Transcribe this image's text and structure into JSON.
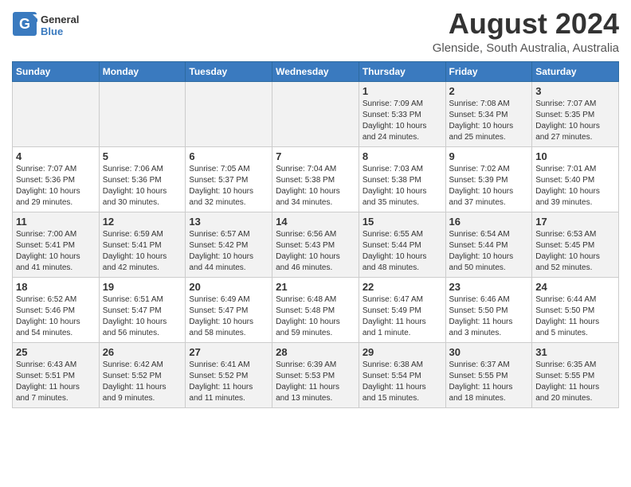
{
  "header": {
    "logo_general": "General",
    "logo_blue": "Blue",
    "main_title": "August 2024",
    "sub_title": "Glenside, South Australia, Australia"
  },
  "days_of_week": [
    "Sunday",
    "Monday",
    "Tuesday",
    "Wednesday",
    "Thursday",
    "Friday",
    "Saturday"
  ],
  "weeks": [
    [
      {
        "day": "",
        "info": ""
      },
      {
        "day": "",
        "info": ""
      },
      {
        "day": "",
        "info": ""
      },
      {
        "day": "",
        "info": ""
      },
      {
        "day": "1",
        "info": "Sunrise: 7:09 AM\nSunset: 5:33 PM\nDaylight: 10 hours\nand 24 minutes."
      },
      {
        "day": "2",
        "info": "Sunrise: 7:08 AM\nSunset: 5:34 PM\nDaylight: 10 hours\nand 25 minutes."
      },
      {
        "day": "3",
        "info": "Sunrise: 7:07 AM\nSunset: 5:35 PM\nDaylight: 10 hours\nand 27 minutes."
      }
    ],
    [
      {
        "day": "4",
        "info": "Sunrise: 7:07 AM\nSunset: 5:36 PM\nDaylight: 10 hours\nand 29 minutes."
      },
      {
        "day": "5",
        "info": "Sunrise: 7:06 AM\nSunset: 5:36 PM\nDaylight: 10 hours\nand 30 minutes."
      },
      {
        "day": "6",
        "info": "Sunrise: 7:05 AM\nSunset: 5:37 PM\nDaylight: 10 hours\nand 32 minutes."
      },
      {
        "day": "7",
        "info": "Sunrise: 7:04 AM\nSunset: 5:38 PM\nDaylight: 10 hours\nand 34 minutes."
      },
      {
        "day": "8",
        "info": "Sunrise: 7:03 AM\nSunset: 5:38 PM\nDaylight: 10 hours\nand 35 minutes."
      },
      {
        "day": "9",
        "info": "Sunrise: 7:02 AM\nSunset: 5:39 PM\nDaylight: 10 hours\nand 37 minutes."
      },
      {
        "day": "10",
        "info": "Sunrise: 7:01 AM\nSunset: 5:40 PM\nDaylight: 10 hours\nand 39 minutes."
      }
    ],
    [
      {
        "day": "11",
        "info": "Sunrise: 7:00 AM\nSunset: 5:41 PM\nDaylight: 10 hours\nand 41 minutes."
      },
      {
        "day": "12",
        "info": "Sunrise: 6:59 AM\nSunset: 5:41 PM\nDaylight: 10 hours\nand 42 minutes."
      },
      {
        "day": "13",
        "info": "Sunrise: 6:57 AM\nSunset: 5:42 PM\nDaylight: 10 hours\nand 44 minutes."
      },
      {
        "day": "14",
        "info": "Sunrise: 6:56 AM\nSunset: 5:43 PM\nDaylight: 10 hours\nand 46 minutes."
      },
      {
        "day": "15",
        "info": "Sunrise: 6:55 AM\nSunset: 5:44 PM\nDaylight: 10 hours\nand 48 minutes."
      },
      {
        "day": "16",
        "info": "Sunrise: 6:54 AM\nSunset: 5:44 PM\nDaylight: 10 hours\nand 50 minutes."
      },
      {
        "day": "17",
        "info": "Sunrise: 6:53 AM\nSunset: 5:45 PM\nDaylight: 10 hours\nand 52 minutes."
      }
    ],
    [
      {
        "day": "18",
        "info": "Sunrise: 6:52 AM\nSunset: 5:46 PM\nDaylight: 10 hours\nand 54 minutes."
      },
      {
        "day": "19",
        "info": "Sunrise: 6:51 AM\nSunset: 5:47 PM\nDaylight: 10 hours\nand 56 minutes."
      },
      {
        "day": "20",
        "info": "Sunrise: 6:49 AM\nSunset: 5:47 PM\nDaylight: 10 hours\nand 58 minutes."
      },
      {
        "day": "21",
        "info": "Sunrise: 6:48 AM\nSunset: 5:48 PM\nDaylight: 10 hours\nand 59 minutes."
      },
      {
        "day": "22",
        "info": "Sunrise: 6:47 AM\nSunset: 5:49 PM\nDaylight: 11 hours\nand 1 minute."
      },
      {
        "day": "23",
        "info": "Sunrise: 6:46 AM\nSunset: 5:50 PM\nDaylight: 11 hours\nand 3 minutes."
      },
      {
        "day": "24",
        "info": "Sunrise: 6:44 AM\nSunset: 5:50 PM\nDaylight: 11 hours\nand 5 minutes."
      }
    ],
    [
      {
        "day": "25",
        "info": "Sunrise: 6:43 AM\nSunset: 5:51 PM\nDaylight: 11 hours\nand 7 minutes."
      },
      {
        "day": "26",
        "info": "Sunrise: 6:42 AM\nSunset: 5:52 PM\nDaylight: 11 hours\nand 9 minutes."
      },
      {
        "day": "27",
        "info": "Sunrise: 6:41 AM\nSunset: 5:52 PM\nDaylight: 11 hours\nand 11 minutes."
      },
      {
        "day": "28",
        "info": "Sunrise: 6:39 AM\nSunset: 5:53 PM\nDaylight: 11 hours\nand 13 minutes."
      },
      {
        "day": "29",
        "info": "Sunrise: 6:38 AM\nSunset: 5:54 PM\nDaylight: 11 hours\nand 15 minutes."
      },
      {
        "day": "30",
        "info": "Sunrise: 6:37 AM\nSunset: 5:55 PM\nDaylight: 11 hours\nand 18 minutes."
      },
      {
        "day": "31",
        "info": "Sunrise: 6:35 AM\nSunset: 5:55 PM\nDaylight: 11 hours\nand 20 minutes."
      }
    ]
  ]
}
